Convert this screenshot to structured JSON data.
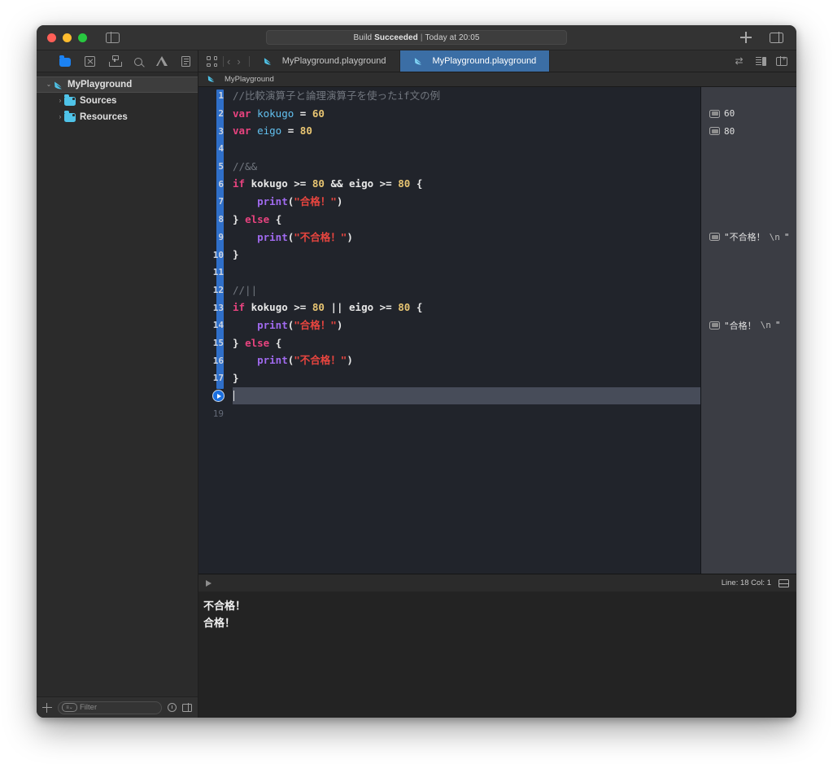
{
  "window": {
    "traffic_lights": [
      "close",
      "minimize",
      "zoom"
    ],
    "status": {
      "prefix": "Build",
      "bold": "Succeeded",
      "separator": "|",
      "suffix": "Today at 20:05"
    }
  },
  "navigator": {
    "icons": [
      "folder-icon",
      "source-control-icon",
      "hierarchy-icon",
      "search-icon",
      "warning-icon",
      "report-icon"
    ],
    "tree": [
      {
        "label": "MyPlayground",
        "icon": "swift-icon",
        "depth": 0,
        "disclosure": "⌄",
        "selected": true
      },
      {
        "label": "Sources",
        "icon": "folder-icon",
        "depth": 1,
        "disclosure": "›",
        "selected": false
      },
      {
        "label": "Resources",
        "icon": "folder-icon",
        "depth": 1,
        "disclosure": "›",
        "selected": false
      }
    ],
    "filter": {
      "placeholder": "Filter",
      "add_label": "+",
      "chip": "≡⌄"
    }
  },
  "tabs": [
    {
      "label": "MyPlayground.playground",
      "active": false
    },
    {
      "label": "MyPlayground.playground",
      "active": true
    }
  ],
  "breadcrumb": {
    "label": "MyPlayground"
  },
  "editor": {
    "lines": [
      {
        "n": "1",
        "tokens": [
          {
            "t": "//比較演算子と論理演算子を使ったif文の例",
            "c": "c-cmt"
          }
        ]
      },
      {
        "n": "2",
        "tokens": [
          {
            "t": "var",
            "c": "c-kw"
          },
          {
            "t": " ",
            "c": "c-plain"
          },
          {
            "t": "kokugo",
            "c": "c-var"
          },
          {
            "t": " = ",
            "c": "c-plain"
          },
          {
            "t": "60",
            "c": "c-num"
          }
        ]
      },
      {
        "n": "3",
        "tokens": [
          {
            "t": "var",
            "c": "c-kw"
          },
          {
            "t": " ",
            "c": "c-plain"
          },
          {
            "t": "eigo",
            "c": "c-var"
          },
          {
            "t": " = ",
            "c": "c-plain"
          },
          {
            "t": "80",
            "c": "c-num"
          }
        ]
      },
      {
        "n": "4",
        "tokens": []
      },
      {
        "n": "5",
        "tokens": [
          {
            "t": "//&&",
            "c": "c-cmt"
          }
        ]
      },
      {
        "n": "6",
        "tokens": [
          {
            "t": "if",
            "c": "c-kw"
          },
          {
            "t": " kokugo >= ",
            "c": "c-plain"
          },
          {
            "t": "80",
            "c": "c-num"
          },
          {
            "t": " && eigo >= ",
            "c": "c-plain"
          },
          {
            "t": "80",
            "c": "c-num"
          },
          {
            "t": " {",
            "c": "c-plain"
          }
        ]
      },
      {
        "n": "7",
        "tokens": [
          {
            "t": "    ",
            "c": "c-plain"
          },
          {
            "t": "print",
            "c": "c-fn"
          },
          {
            "t": "(",
            "c": "c-plain"
          },
          {
            "t": "\"合格！\"",
            "c": "c-str"
          },
          {
            "t": ")",
            "c": "c-plain"
          }
        ]
      },
      {
        "n": "8",
        "tokens": [
          {
            "t": "} ",
            "c": "c-plain"
          },
          {
            "t": "else",
            "c": "c-kw"
          },
          {
            "t": " {",
            "c": "c-plain"
          }
        ]
      },
      {
        "n": "9",
        "tokens": [
          {
            "t": "    ",
            "c": "c-plain"
          },
          {
            "t": "print",
            "c": "c-fn"
          },
          {
            "t": "(",
            "c": "c-plain"
          },
          {
            "t": "\"不合格！\"",
            "c": "c-str"
          },
          {
            "t": ")",
            "c": "c-plain"
          }
        ]
      },
      {
        "n": "10",
        "tokens": [
          {
            "t": "}",
            "c": "c-plain"
          }
        ]
      },
      {
        "n": "11",
        "tokens": []
      },
      {
        "n": "12",
        "tokens": [
          {
            "t": "//||",
            "c": "c-cmt"
          }
        ]
      },
      {
        "n": "13",
        "tokens": [
          {
            "t": "if",
            "c": "c-kw"
          },
          {
            "t": " kokugo >= ",
            "c": "c-plain"
          },
          {
            "t": "80",
            "c": "c-num"
          },
          {
            "t": " || eigo >= ",
            "c": "c-plain"
          },
          {
            "t": "80",
            "c": "c-num"
          },
          {
            "t": " {",
            "c": "c-plain"
          }
        ]
      },
      {
        "n": "14",
        "tokens": [
          {
            "t": "    ",
            "c": "c-plain"
          },
          {
            "t": "print",
            "c": "c-fn"
          },
          {
            "t": "(",
            "c": "c-plain"
          },
          {
            "t": "\"合格！\"",
            "c": "c-str"
          },
          {
            "t": ")",
            "c": "c-plain"
          }
        ]
      },
      {
        "n": "15",
        "tokens": [
          {
            "t": "} ",
            "c": "c-plain"
          },
          {
            "t": "else",
            "c": "c-kw"
          },
          {
            "t": " {",
            "c": "c-plain"
          }
        ]
      },
      {
        "n": "16",
        "tokens": [
          {
            "t": "    ",
            "c": "c-plain"
          },
          {
            "t": "print",
            "c": "c-fn"
          },
          {
            "t": "(",
            "c": "c-plain"
          },
          {
            "t": "\"不合格！\"",
            "c": "c-str"
          },
          {
            "t": ")",
            "c": "c-plain"
          }
        ]
      },
      {
        "n": "17",
        "tokens": [
          {
            "t": "}",
            "c": "c-plain"
          }
        ]
      },
      {
        "n": "",
        "tokens": [],
        "current": true,
        "run_button": true
      },
      {
        "n": "19",
        "tokens": [],
        "dim": true
      }
    ],
    "results": [
      {
        "line": 2,
        "value": "60"
      },
      {
        "line": 3,
        "value": "80"
      },
      {
        "line": 9,
        "value": "\"不合格！",
        "escape": "\\n",
        "tail": "\""
      },
      {
        "line": 14,
        "value": "\"合格！",
        "escape": "\\n",
        "tail": "\""
      }
    ],
    "toolbar_icons": [
      "swap-icon",
      "editor-options-icon",
      "add-editor-icon"
    ]
  },
  "console": {
    "lines": [
      "不合格！",
      "合格！"
    ],
    "line_col": "Line: 18  Col: 1"
  },
  "colors": {
    "accent_blue": "#2f6fc9",
    "tab_active": "#3b6ea5",
    "keyword": "#e8437f",
    "identifier": "#62c0ef",
    "number": "#e8c572",
    "function": "#a06aee",
    "string": "#e8453f",
    "comment": "#72777f"
  }
}
